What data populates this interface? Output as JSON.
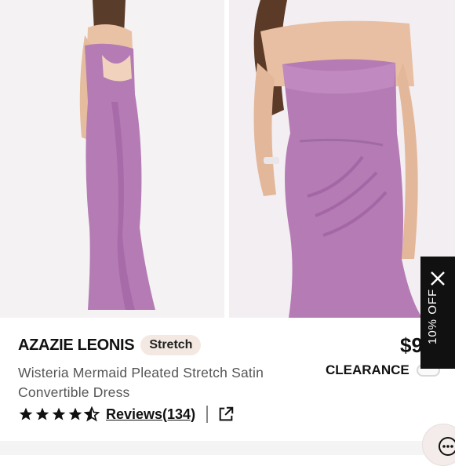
{
  "product": {
    "brand": "AZAZIE LEONIS",
    "badge": "Stretch",
    "title": "Wisteria Mermaid Pleated Stretch Satin Convertible Dress",
    "price": "$9",
    "clearance_label": "CLEARANCE",
    "clearance_toggle_on": false,
    "rating": 4.5,
    "reviews_label": "Reviews(134)"
  },
  "promo": {
    "label": "10% OFF"
  },
  "colors": {
    "dress": "#b57bb5",
    "dress_shade": "#9c5f9e",
    "promo_bg": "#111111",
    "badge_bg": "#f3e9e2"
  },
  "icons": {
    "close": "close-icon",
    "share": "external-link-icon",
    "chat": "chat-icon",
    "star": "star-icon"
  }
}
